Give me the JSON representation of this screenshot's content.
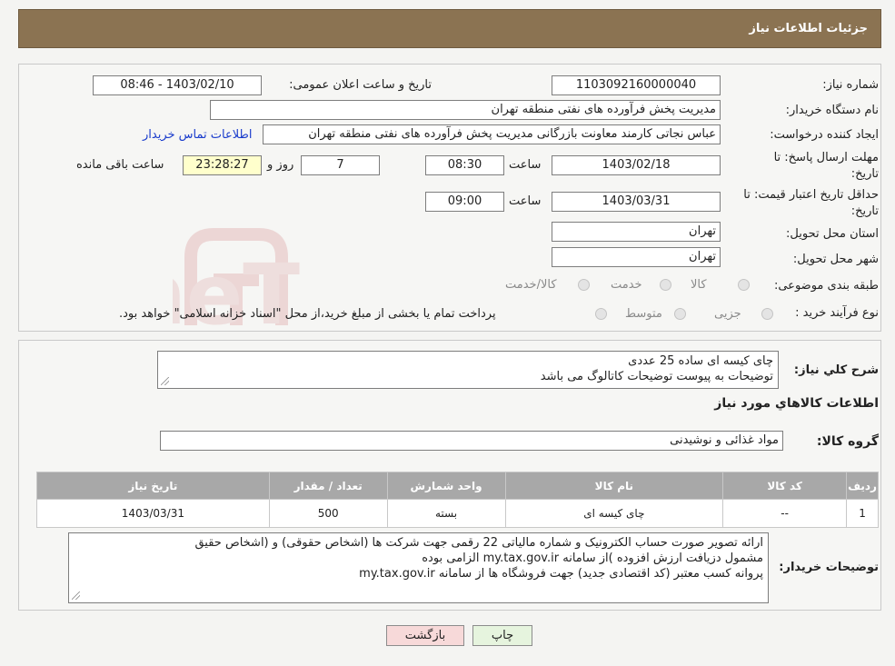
{
  "header": {
    "title": "جزئیات اطلاعات نیاز"
  },
  "form": {
    "need_number_label": "شماره نیاز:",
    "need_number": "1103092160000040",
    "announce_label": "تاریخ و ساعت اعلان عمومی:",
    "announce_value": "1403/02/10 - 08:46",
    "buyer_org_label": "نام دستگاه خریدار:",
    "buyer_org": "مدیریت پخش فرآورده های نفتی منطقه تهران",
    "creator_label": "ایجاد کننده درخواست:",
    "creator": "عباس نجاتی کارمند معاونت بازرگانی مدیریت پخش فرآورده های نفتی منطقه تهران",
    "contact_link": "اطلاعات تماس خریدار",
    "deadline_label_1": "مهلت ارسال پاسخ: تا",
    "deadline_label_2": "تاریخ:",
    "deadline_date": "1403/02/18",
    "time_label": "ساعت",
    "deadline_time": "08:30",
    "days_value": "7",
    "days_label": "روز و",
    "remaining_value": "23:28:27",
    "remaining_label": "ساعت باقی مانده",
    "validity_label_1": "حداقل تاریخ اعتبار قیمت: تا",
    "validity_label_2": "تاریخ:",
    "validity_date": "1403/03/31",
    "validity_time": "09:00",
    "province_label": "استان محل تحویل:",
    "province": "تهران",
    "city_label": "شهر محل تحویل:",
    "city": "تهران",
    "category_label": "طبقه بندی موضوعی:",
    "category_options": [
      "کالا",
      "خدمت",
      "کالا/خدمت"
    ],
    "process_label": "نوع فرآیند خرید :",
    "process_options": [
      "جزیی",
      "متوسط"
    ],
    "process_note": "پرداخت تمام یا بخشی از مبلغ خرید،از محل \"اسناد خزانه اسلامی\" خواهد بود."
  },
  "description": {
    "label": "شرح کلي نياز:",
    "line1": "چای کیسه ای ساده 25 عددی",
    "line2": "توضیحات به پیوست توضیحات کاتالوگ می باشد"
  },
  "goods_info_title": "اطلاعات کالاهاي مورد نياز",
  "goods_group": {
    "label": "گروه کالا:",
    "value": "مواد غذائی و نوشیدنی"
  },
  "table": {
    "headers": [
      "ردیف",
      "کد کالا",
      "نام کالا",
      "واحد شمارش",
      "تعداد / مقدار",
      "تاریخ نیاز"
    ],
    "rows": [
      [
        "1",
        "--",
        "چای کیسه ای",
        "بسته",
        "500",
        "1403/03/31"
      ]
    ]
  },
  "buyer_notes": {
    "label": "توضیحات خریدار:",
    "line1": "ارائه  تصویر صورت حساب الکترونیک و شماره مالیاتی 22 رقمی  جهت شرکت ها (اشخاص حقوقی) و (اشخاص حقیق",
    "line2": "مشمول دزیافت ارزش افزوده )از سامانه my.tax.gov.ir  الزامی بوده",
    "line3": "پروانه کسب معتبر (کد اقتصادی جدید) جهت فروشگاه ها از سامانه my.tax.gov.ir"
  },
  "buttons": {
    "print": "چاپ",
    "back": "بازگشت"
  },
  "watermark": {
    "text": "AriaTender.neT"
  },
  "colors": {
    "header": "#8b7352",
    "link": "#1a3ccc",
    "back_button": "#f7d9d9",
    "print_button": "#e6f4de"
  }
}
